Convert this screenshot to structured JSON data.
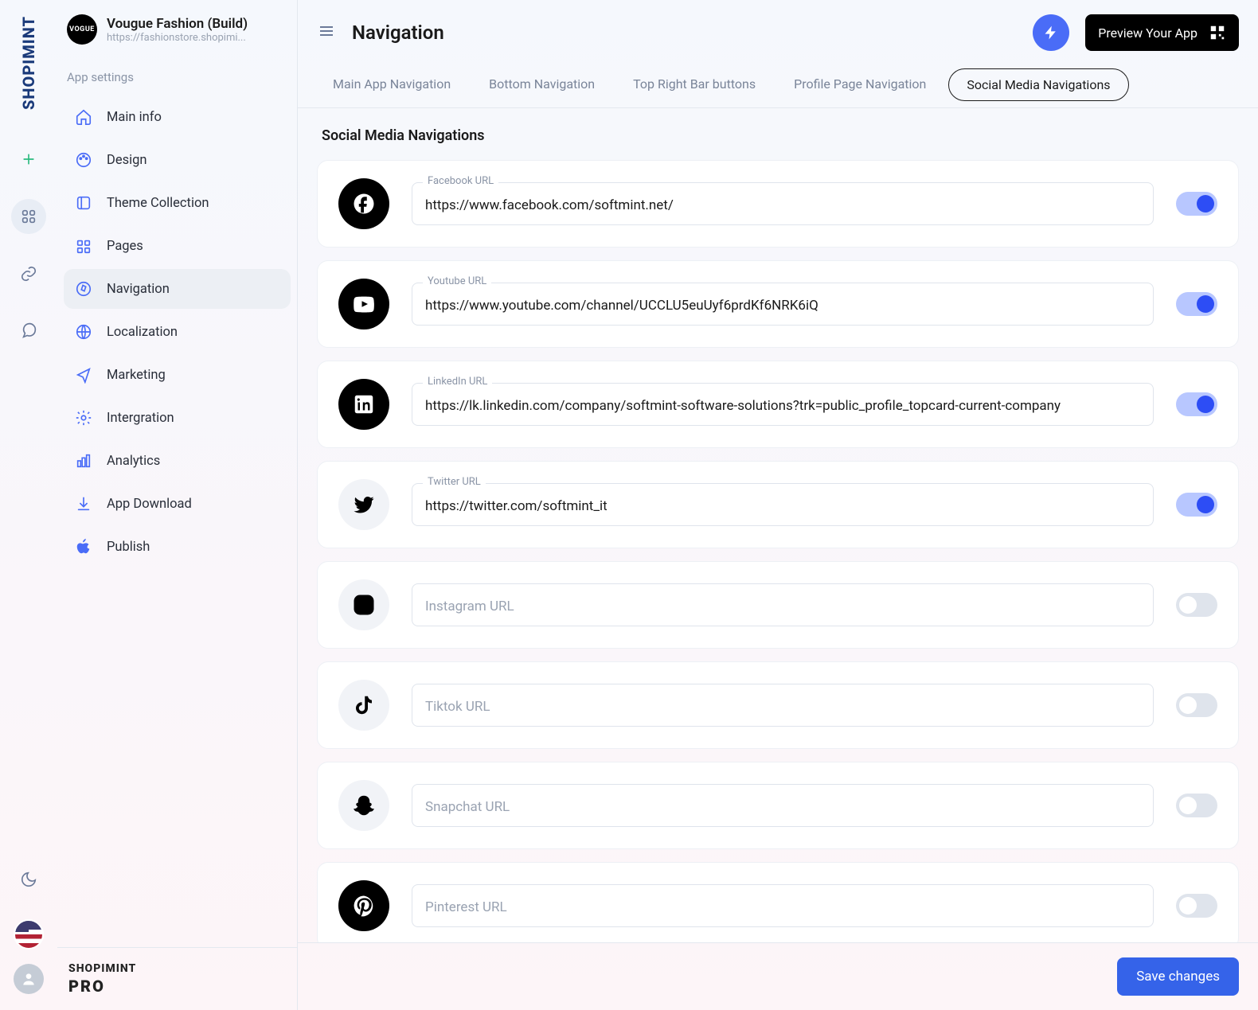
{
  "rail": {
    "logo": "SHOPIMINT"
  },
  "sidebar": {
    "app_name": "Vougue Fashion (Build)",
    "app_url": "https://fashionstore.shopimi...",
    "section_label": "App settings",
    "items": [
      {
        "label": "Main info"
      },
      {
        "label": "Design"
      },
      {
        "label": "Theme Collection"
      },
      {
        "label": "Pages"
      },
      {
        "label": "Navigation"
      },
      {
        "label": "Localization"
      },
      {
        "label": "Marketing"
      },
      {
        "label": "Intergration"
      },
      {
        "label": "Analytics"
      },
      {
        "label": "App Download"
      },
      {
        "label": "Publish"
      }
    ],
    "footer_brand": "SHOPIMINT",
    "footer_tier": "PRO"
  },
  "topbar": {
    "page_title": "Navigation",
    "preview_label": "Preview Your App"
  },
  "tabs": [
    {
      "label": "Main App Navigation"
    },
    {
      "label": "Bottom Navigation"
    },
    {
      "label": "Top Right Bar buttons"
    },
    {
      "label": "Profile Page Navigation"
    },
    {
      "label": "Social Media Navigations"
    }
  ],
  "content": {
    "title": "Social Media Navigations",
    "socials": [
      {
        "name": "facebook",
        "label": "Facebook URL",
        "value": "https://www.facebook.com/softmint.net/",
        "enabled": true,
        "dark": true
      },
      {
        "name": "youtube",
        "label": "Youtube URL",
        "value": "https://www.youtube.com/channel/UCCLU5euUyf6prdKf6NRK6iQ",
        "enabled": true,
        "dark": true
      },
      {
        "name": "linkedin",
        "label": "LinkedIn URL",
        "value": "https://lk.linkedin.com/company/softmint-software-solutions?trk=public_profile_topcard-current-company",
        "enabled": true,
        "dark": true
      },
      {
        "name": "twitter",
        "label": "Twitter URL",
        "value": "https://twitter.com/softmint_it",
        "enabled": true,
        "dark": false
      },
      {
        "name": "instagram",
        "label": "Instagram URL",
        "value": "",
        "enabled": false,
        "dark": false
      },
      {
        "name": "tiktok",
        "label": "Tiktok URL",
        "value": "",
        "enabled": false,
        "dark": false
      },
      {
        "name": "snapchat",
        "label": "Snapchat URL",
        "value": "",
        "enabled": false,
        "dark": false
      },
      {
        "name": "pinterest",
        "label": "Pinterest URL",
        "value": "",
        "enabled": false,
        "dark": true
      }
    ]
  },
  "footer": {
    "save_label": "Save changes"
  }
}
